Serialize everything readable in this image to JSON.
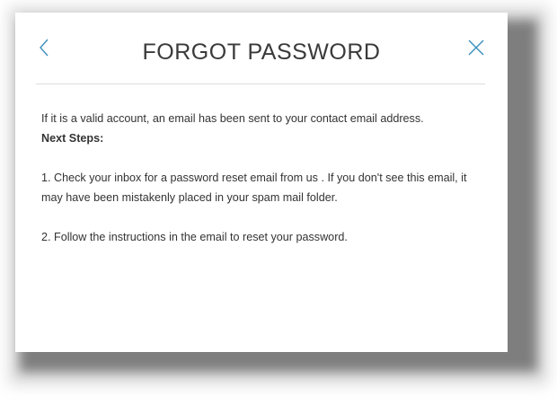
{
  "dialog": {
    "title": "FORGOT PASSWORD",
    "back_icon": "chevron-left-icon",
    "close_icon": "close-icon",
    "accent_color": "#3a8fbd",
    "intro": "If it is a valid account, an email has been sent to your contact email address.",
    "next_steps_label": "Next Steps:",
    "step_1": "1. Check your inbox for a password reset email from us . If you don't see this email, it may have been mistakenly placed in your spam mail folder.",
    "step_2": "2. Follow the instructions in the email to reset your password."
  }
}
